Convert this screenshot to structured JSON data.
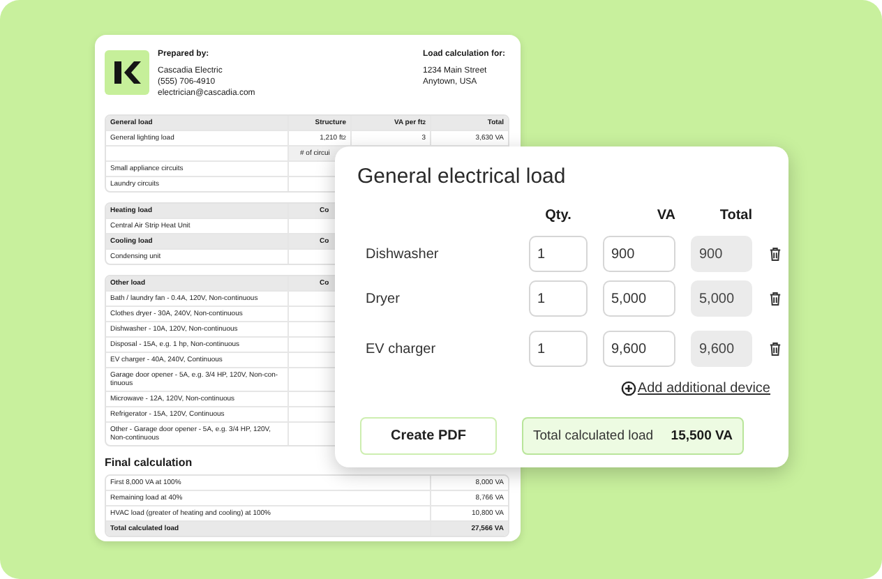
{
  "document": {
    "prepared_by_label": "Prepared by:",
    "preparer": [
      "Cascadia Electric",
      "(555) 706-4910",
      "electrician@cascadia.com"
    ],
    "load_for_label": "Load calculation for:",
    "address": [
      "1234 Main Street",
      "Anytown, USA"
    ],
    "tables": [
      {
        "rows": [
          {
            "kind": "header",
            "cells": [
              "General load",
              "Structure",
              "VA per ft$^{2}$",
              "Total"
            ]
          },
          {
            "kind": "data",
            "cells": [
              "General lighting load",
              "1,210 ft$^{2}$",
              "3",
              "3,630 VA"
            ]
          },
          {
            "kind": "subheader",
            "cells": [
              "# of circui"
            ]
          },
          {
            "kind": "data",
            "cells": [
              "Small appliance circuits"
            ]
          },
          {
            "kind": "data",
            "cells": [
              "Laundry circuits"
            ]
          }
        ]
      },
      {
        "rows": [
          {
            "kind": "header",
            "cells": [
              "Heating load",
              "Co"
            ]
          },
          {
            "kind": "data",
            "cells": [
              "Central Air Strip Heat Unit"
            ]
          },
          {
            "kind": "header",
            "cells": [
              "Cooling load",
              "Co"
            ]
          },
          {
            "kind": "data",
            "cells": [
              "Condensing unit"
            ]
          }
        ]
      },
      {
        "rows": [
          {
            "kind": "header",
            "cells": [
              "Other load",
              "Co"
            ]
          },
          {
            "kind": "data",
            "cells": [
              "Bath / laundry fan - 0.4A, 120V, Non-continuous"
            ]
          },
          {
            "kind": "data",
            "cells": [
              "Clothes dryer - 30A, 240V, Non-continuous"
            ]
          },
          {
            "kind": "data",
            "cells": [
              "Dishwasher - 10A, 120V, Non-continuous"
            ]
          },
          {
            "kind": "data",
            "cells": [
              "Disposal - 15A, e.g. 1 hp, Non-continuous"
            ]
          },
          {
            "kind": "data",
            "cells": [
              "EV charger - 40A, 240V, Continuous"
            ]
          },
          {
            "kind": "data",
            "cells": [
              "Garage door opener - 5A, e.g. 3/4 HP, 120V, Non-con-tinuous"
            ]
          },
          {
            "kind": "data",
            "cells": [
              "Microwave - 12A, 120V, Non-continuous"
            ]
          },
          {
            "kind": "data",
            "cells": [
              "Refrigerator - 15A, 120V, Continuous"
            ]
          },
          {
            "kind": "data",
            "cells": [
              "Other - Garage door opener - 5A, e.g. 3/4 HP, 120V, Non-continuous"
            ]
          }
        ]
      }
    ],
    "final": {
      "title": "Final calculation",
      "rows": [
        {
          "cells": [
            "First 8,000 VA at 100%",
            "8,000 VA"
          ],
          "total": false
        },
        {
          "cells": [
            "Remaining load at 40%",
            "8,766 VA"
          ],
          "total": false
        },
        {
          "cells": [
            "HVAC load (greater of heating and cooling) at 100%",
            "10,800 VA"
          ],
          "total": false
        },
        {
          "cells": [
            "Total calculated load",
            "27,566 VA"
          ],
          "total": true
        }
      ]
    }
  },
  "calculator": {
    "title": "General electrical load",
    "columns": [
      "Qty.",
      "VA",
      "Total"
    ],
    "devices": [
      {
        "name": "Dishwasher",
        "qty": "1",
        "va": "900",
        "total": "900"
      },
      {
        "name": "Dryer",
        "qty": "1",
        "va": "5,000",
        "total": "5,000"
      },
      {
        "name": "EV charger",
        "qty": "1",
        "va": "9,600",
        "total": "9,600"
      }
    ],
    "add_link": "Add additional device",
    "create_button": "Create PDF",
    "total_label": "Total calculated load",
    "total_value": "15,500 VA"
  }
}
